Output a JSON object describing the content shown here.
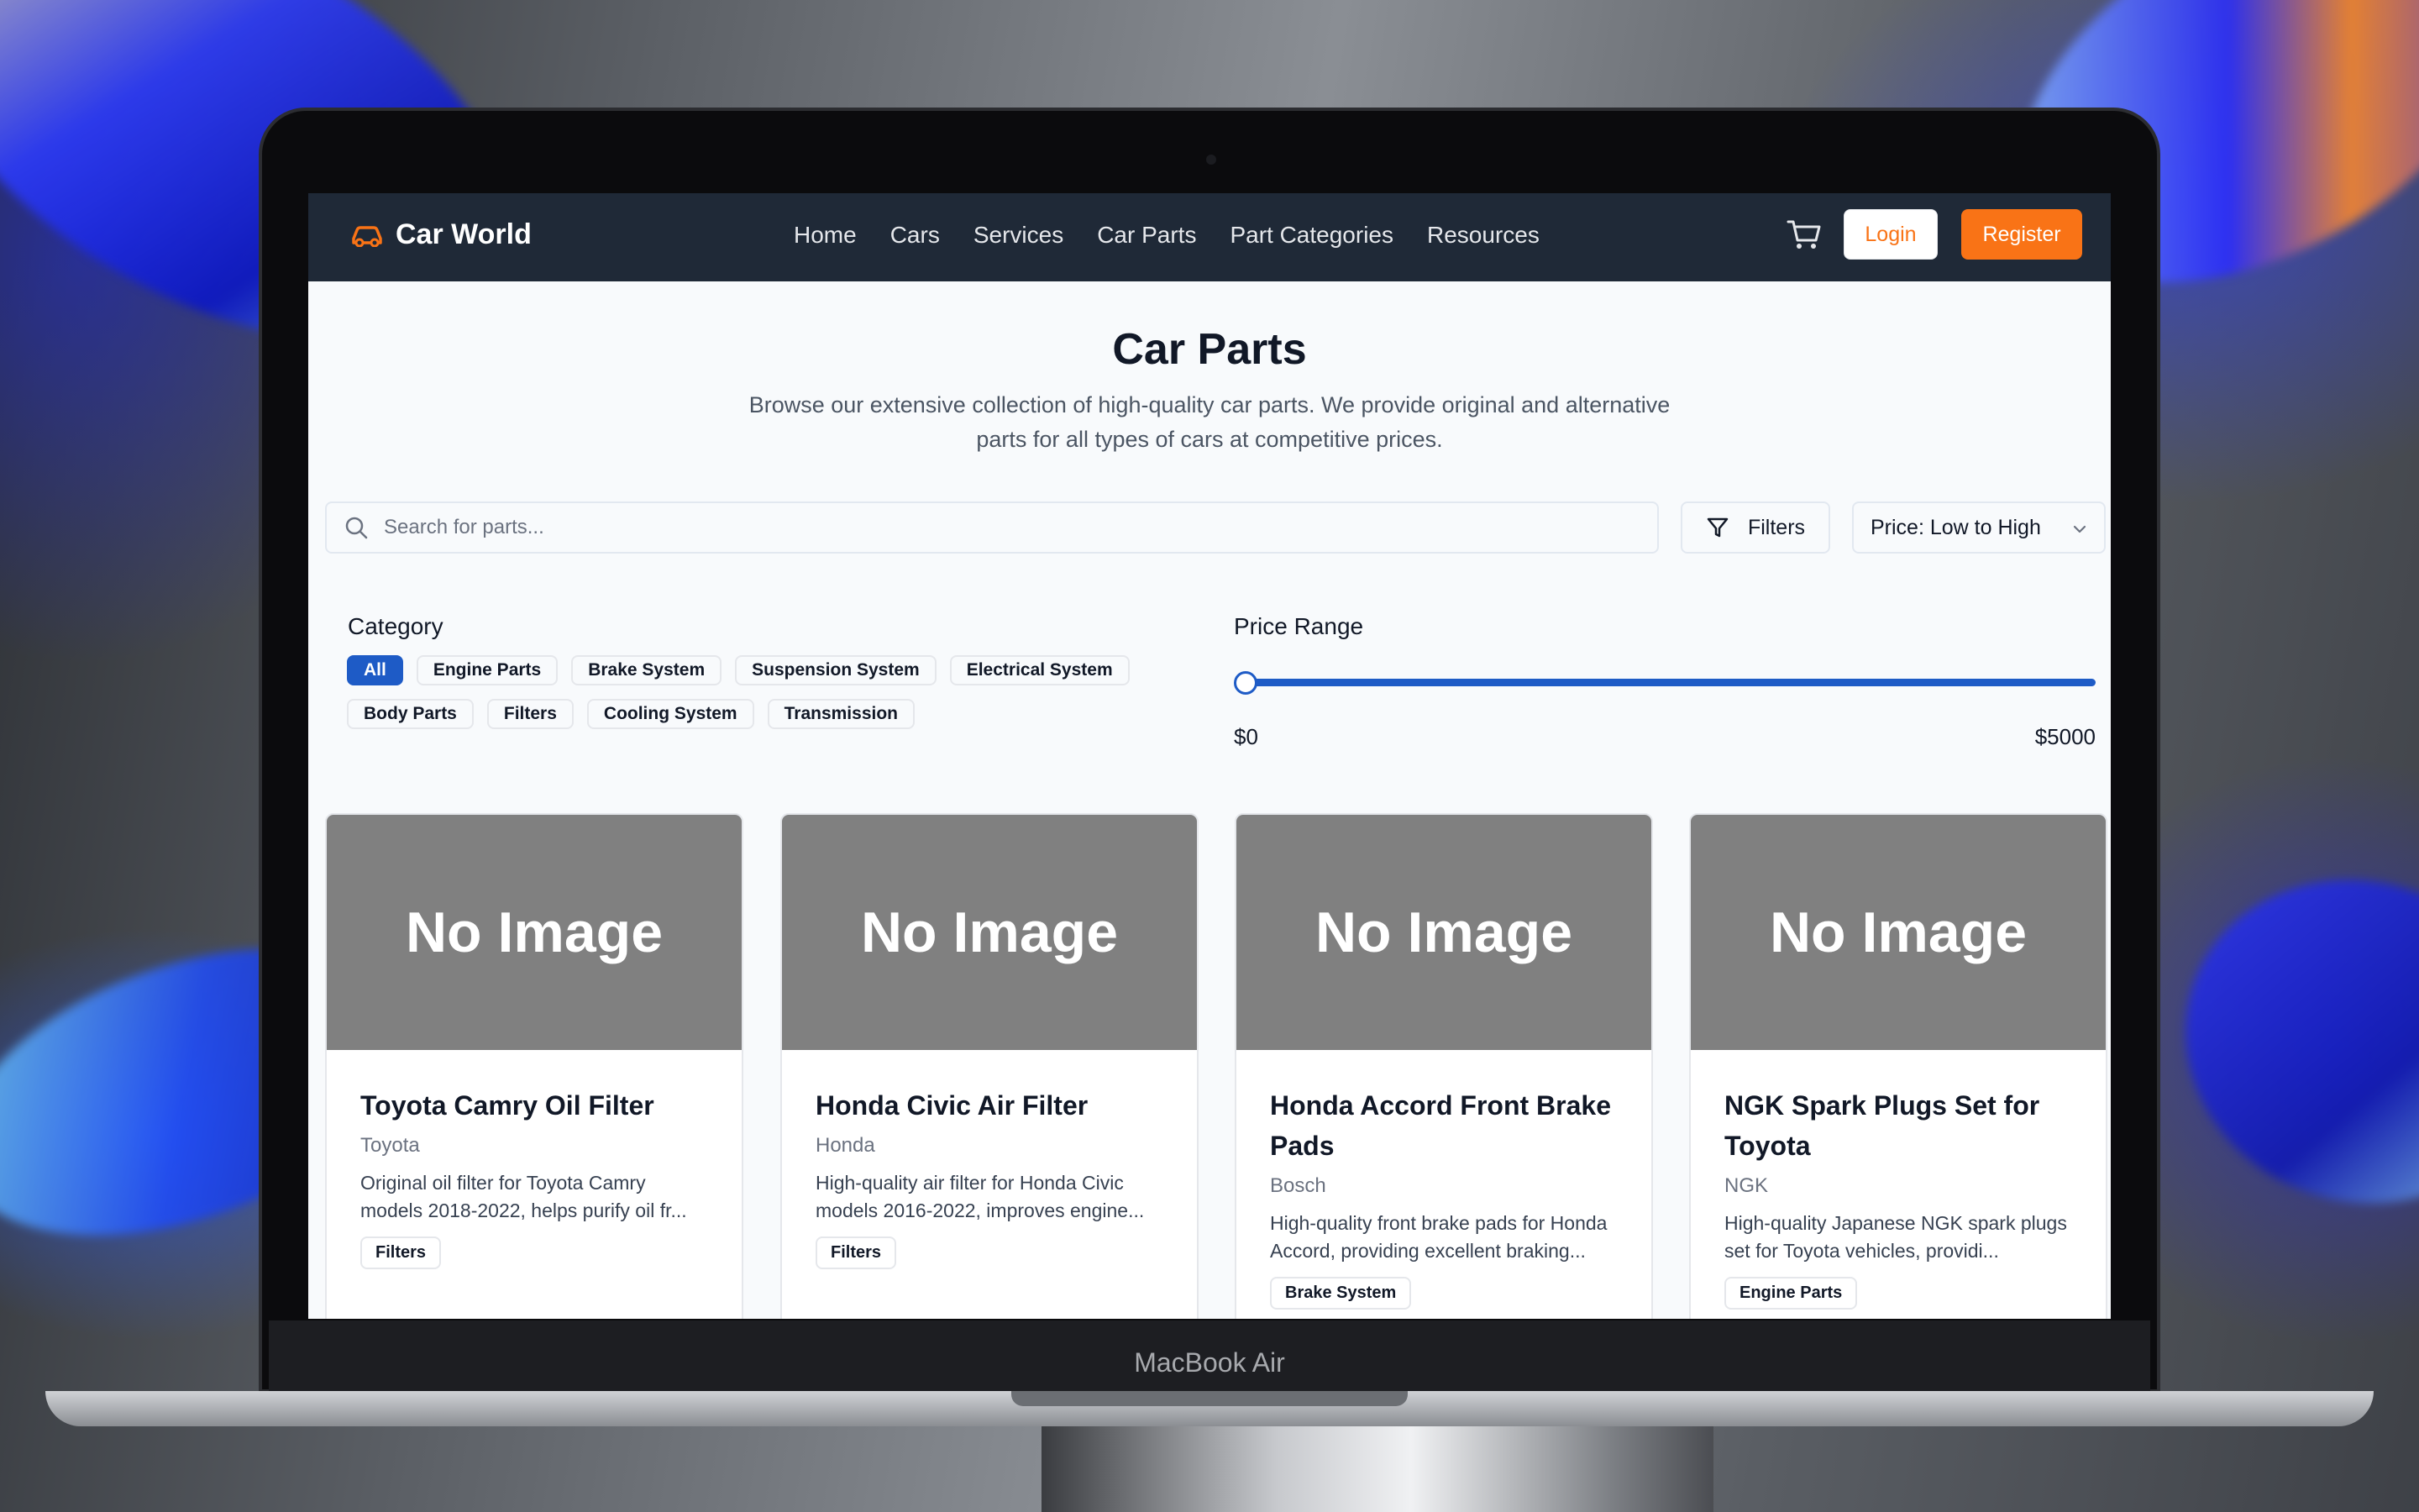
{
  "brand": {
    "name": "Car World"
  },
  "nav": {
    "links": [
      "Home",
      "Cars",
      "Services",
      "Car Parts",
      "Part Categories",
      "Resources"
    ]
  },
  "auth": {
    "login": "Login",
    "register": "Register"
  },
  "hero": {
    "title": "Car Parts",
    "subtitle": "Browse our extensive collection of high-quality car parts. We provide original and alternative parts for all types of cars at competitive prices."
  },
  "search": {
    "placeholder": "Search for parts..."
  },
  "filters_button": "Filters",
  "sort": {
    "selected": "Price: Low to High"
  },
  "category": {
    "label": "Category",
    "chips": [
      "All",
      "Engine Parts",
      "Brake System",
      "Suspension System",
      "Electrical System",
      "Body Parts",
      "Filters",
      "Cooling System",
      "Transmission"
    ],
    "active": "All"
  },
  "price_range": {
    "label": "Price Range",
    "min": "$0",
    "max": "$5000",
    "slider_value_fraction": 0
  },
  "products": [
    {
      "image_text": "No Image",
      "title": "Toyota Camry Oil Filter",
      "brand": "Toyota",
      "description": "Original oil filter for Toyota Camry models 2018-2022, helps purify oil fr...",
      "tag": "Filters"
    },
    {
      "image_text": "No Image",
      "title": "Honda Civic Air Filter",
      "brand": "Honda",
      "description": "High-quality air filter for Honda Civic models 2016-2022, improves engine...",
      "tag": "Filters"
    },
    {
      "image_text": "No Image",
      "title": "Honda Accord Front Brake Pads",
      "brand": "Bosch",
      "description": "High-quality front brake pads for Honda Accord, providing excellent braking...",
      "tag": "Brake System"
    },
    {
      "image_text": "No Image",
      "title": "NGK Spark Plugs Set for Toyota",
      "brand": "NGK",
      "description": "High-quality Japanese NGK spark plugs set for Toyota vehicles, providi...",
      "tag": "Engine Parts"
    }
  ],
  "device": {
    "label": "MacBook Air"
  },
  "colors": {
    "accent": "#f97316",
    "primary": "#1e5bc6",
    "navbar": "#1f2937",
    "image_placeholder": "#808080"
  },
  "icons": [
    "car-icon",
    "cart-icon",
    "search-icon",
    "filter-icon",
    "chevron-down-icon"
  ]
}
